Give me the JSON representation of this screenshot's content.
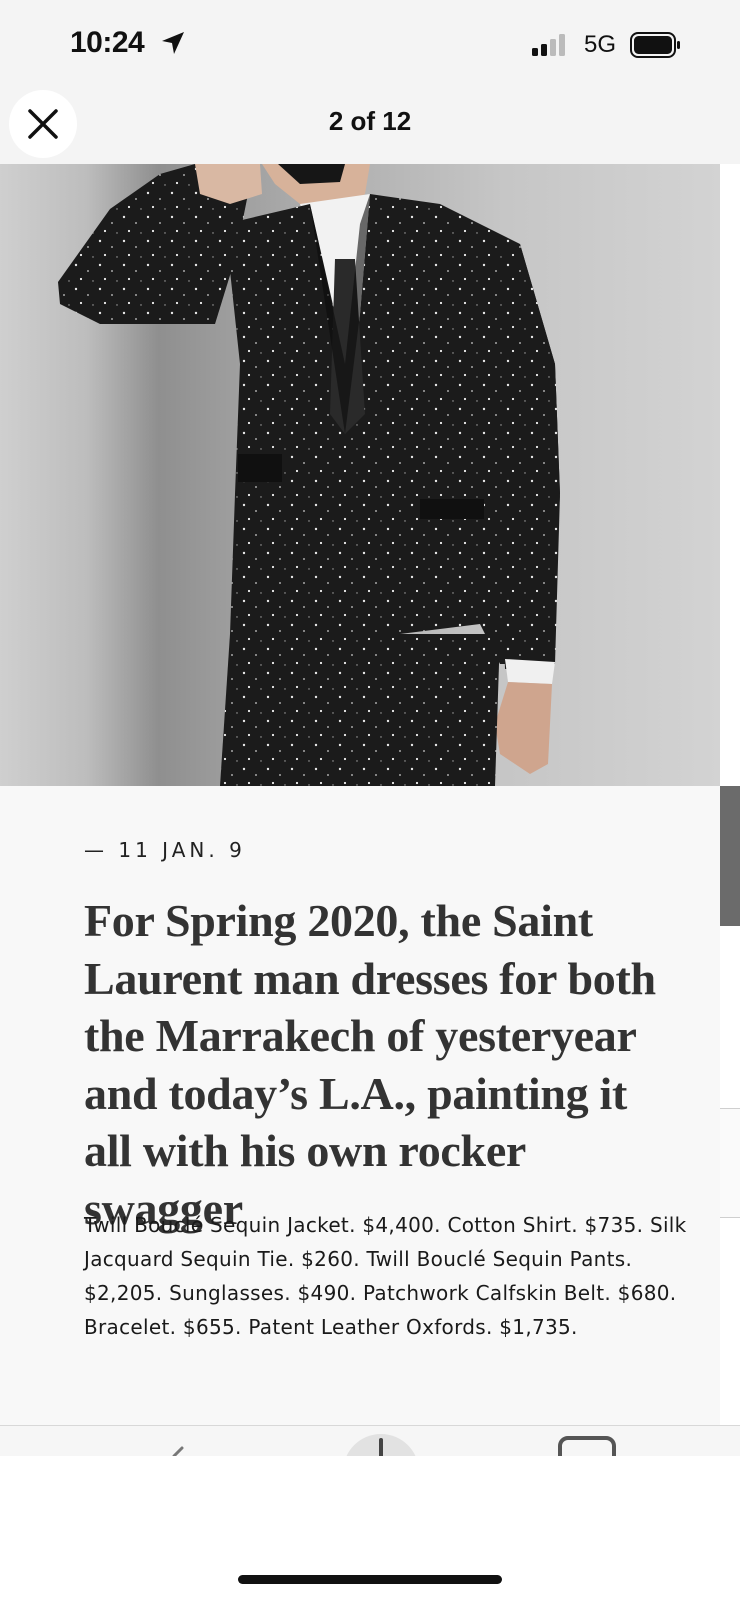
{
  "status_bar": {
    "time": "10:24",
    "network": "5G",
    "icons": [
      "location-arrow-icon",
      "signal-icon",
      "battery-icon"
    ]
  },
  "viewer": {
    "counter": "2 of 12",
    "close_icon": "close-icon"
  },
  "article": {
    "dateline": "— 11 JAN. 9",
    "headline": "For Spring 2020, the Saint Laurent man dresses for both the Marrakech of yesteryear and today’s L.A., painting it all with his own rocker swagger",
    "caption": "Twill Bouclé Sequin Jacket. $4,400. Cotton Shirt. $735. Silk Jacquard Sequin Tie. $260. Twill Bouclé Sequin Pants. $2,205. Sunglasses. $490. Patchwork Calfskin Belt. $680. Bracelet. $655. Patent Leather Oxfords. $1,735."
  },
  "toolbar": {
    "icons": [
      "share-icon",
      "add-icon",
      "tabs-icon"
    ]
  },
  "colors": {
    "background": "#ffffff",
    "header_bg": "#f4f4f4",
    "article_bg": "#f8f8f8",
    "headline_text": "#333333"
  }
}
